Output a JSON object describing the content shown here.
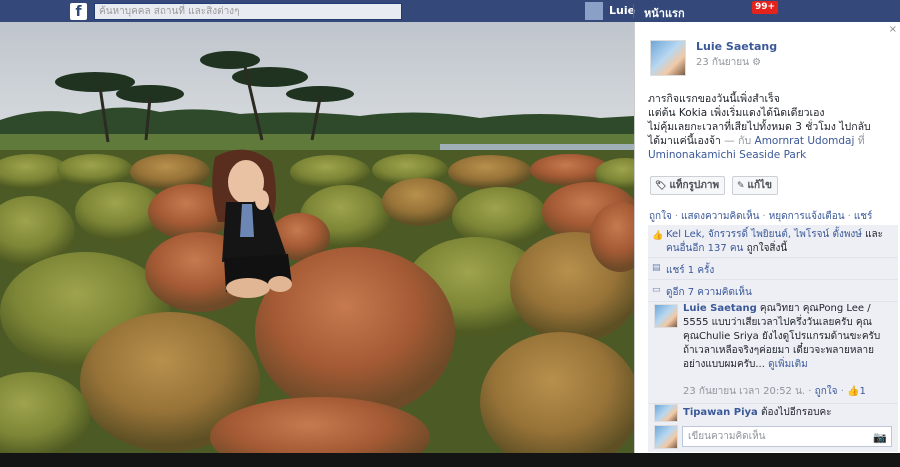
{
  "topbar": {
    "logo_letter": "f",
    "search_placeholder": "ค้นหาบุคคล สถานที่ และสิ่งต่างๆ",
    "user_name": "Luie",
    "home_label": "หน้าแรก",
    "notification_count": "99+"
  },
  "photo": {
    "description_colors": {
      "sky": "#c6ccd3",
      "grass": "#5c6b2e",
      "bush_red": "#b0623a",
      "bush_green": "#7e8b38"
    }
  },
  "post": {
    "close_glyph": "×",
    "author": "Luie Saetang",
    "date": "23 กันยายน",
    "privacy_glyph": "⚙",
    "caption_line1": "ภารกิจแรกของวันนี้เพิ่งสำเร็จ",
    "caption_line2": "แต่ต้น Kokia เพิ่งเริ่มแดงได้นิดเดียวเอง",
    "caption_line3": "ไม่คุ้มเลยกะเวลาที่เสียไปทั้งหมด 3 ชั่วโมง ไปกลับ",
    "caption_line4_prefix": "ได้มาแค่นี้เองจ้า",
    "caption_with": " — กับ ",
    "tagged_person": "Amornrat Udomdaj",
    "caption_at": " ที่",
    "place": "Uminonakamichi Seaside Park",
    "tag_button": "แท็กรูปภาพ",
    "edit_button": "แก้ไข",
    "action_like": "ถูกใจ",
    "action_comment": "แสดงความคิดเห็น",
    "action_stop": "หยุดการแจ้งเตือน",
    "action_share": "แชร์",
    "likes_names": "Kel Lek, จักรวรรดิ์ ไพยิยนต์, ไพโรจน์ ตั้งพงษ์",
    "likes_and": " และ",
    "likes_others": "คนอื่นอีก 137 คน",
    "likes_suffix": " ถูกใจสิ่งนี้",
    "shares": "แชร์ 1 ครั้ง",
    "view_more": "ดูอีก 7 ความคิดเห็น",
    "comment1_author": "Luie Saetang",
    "comment1_text": " คุณวิทยา คุณPong Lee / 5555 แบบว่าเสียเวลาไปครึ่งวันเลยครับ คุณ",
    "comment1_text2": "คุณChulie Sriya ยังไงดูโปรแกรมด้านขะครับ ถ้าเวลาเหลือจริงๆค่อยมา เดี๋ยวจะพลายหลายอย่างแบบผมครับ... ",
    "comment1_see_more": "ดูเพิ่มเติม",
    "comment1_time": "23 กันยายน เวลา 20:52 น.",
    "comment1_like": "ถูกใจ",
    "comment1_likes": "1",
    "comment2_author": "Tipawan Piya",
    "comment2_text": " ต้องไปอีกรอบคะ",
    "write_placeholder": "เขียนความคิดเห็น"
  }
}
